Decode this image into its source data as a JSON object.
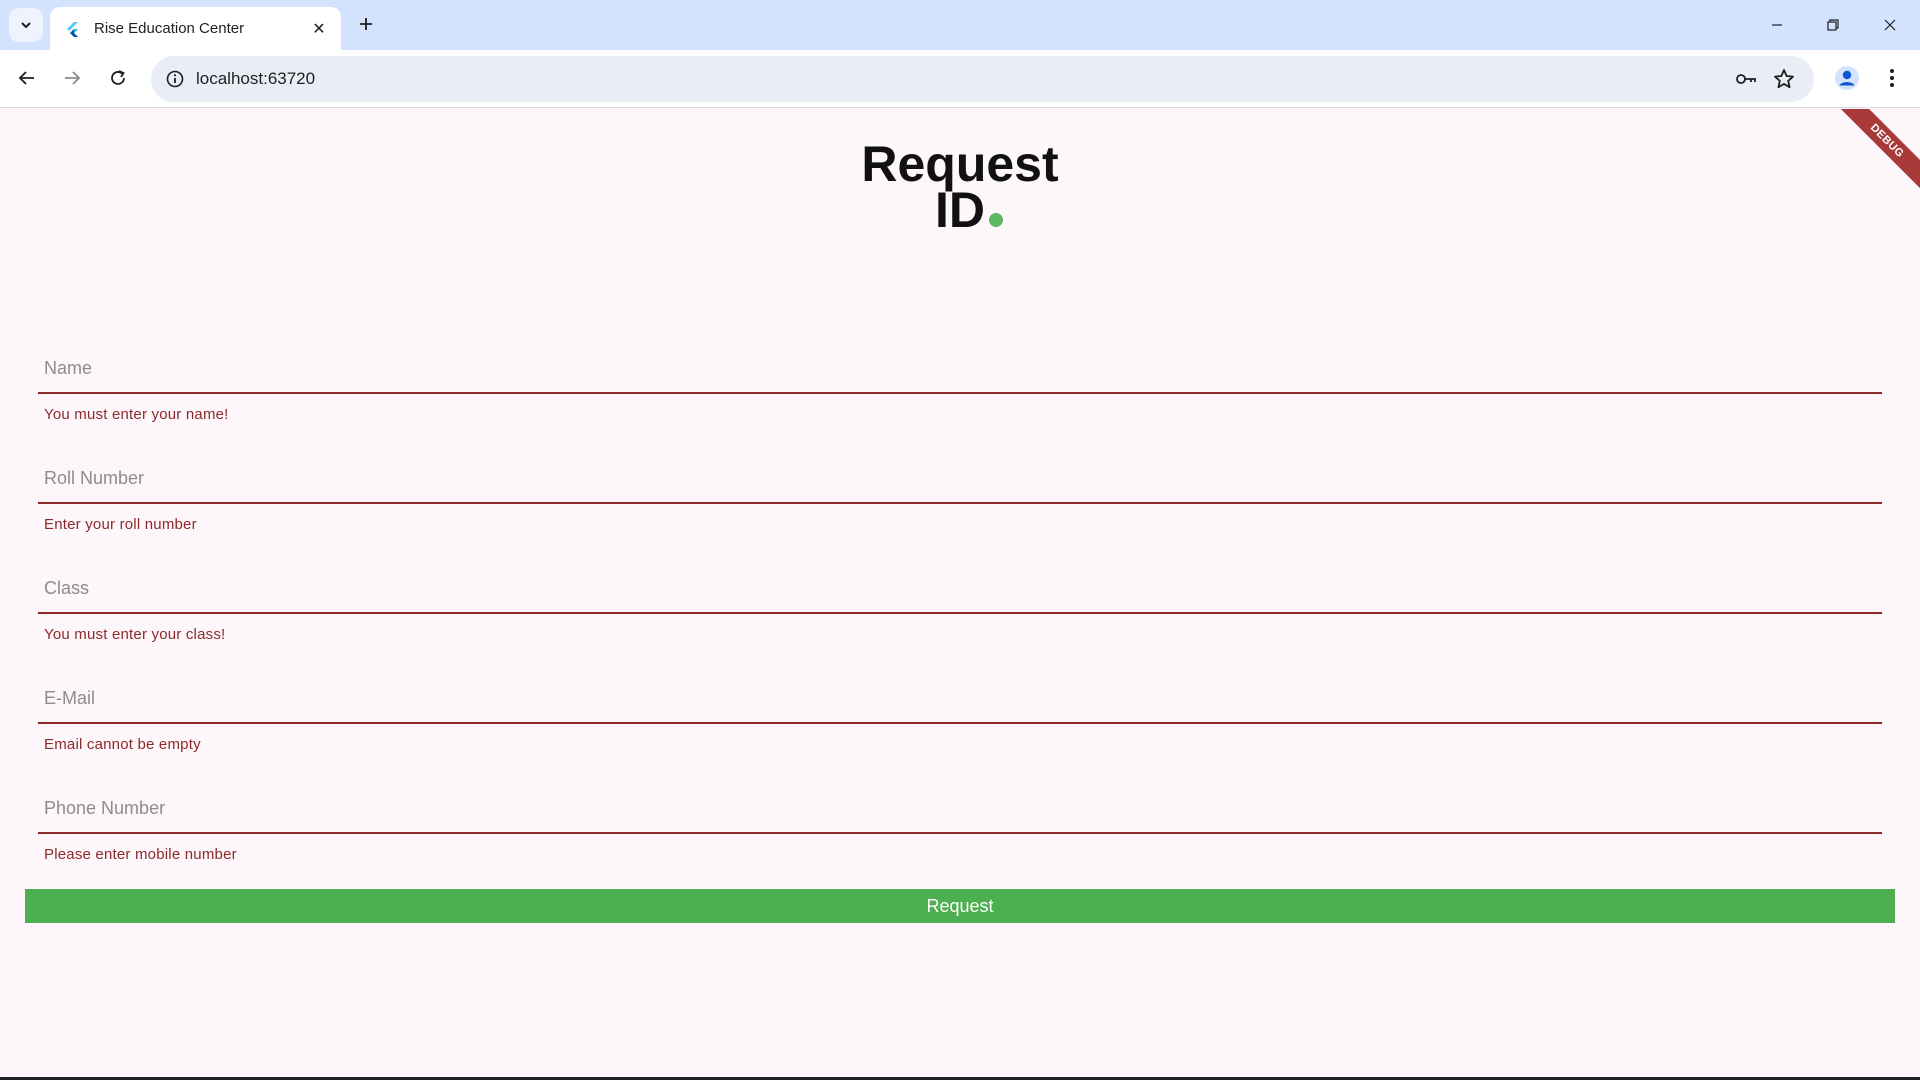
{
  "browser": {
    "tab_title": "Rise Education Center",
    "url": "localhost:63720"
  },
  "app": {
    "debug_label": "DEBUG",
    "title_line1": "Request",
    "title_line2": "ID",
    "accent_color": "#5cba62",
    "error_color": "#8c2a2a",
    "fields": [
      {
        "label": "Name",
        "error": "You must enter your name!"
      },
      {
        "label": "Roll Number",
        "error": "Enter your roll number"
      },
      {
        "label": "Class",
        "error": "You must enter your class!"
      },
      {
        "label": "E-Mail",
        "error": "Email cannot be empty"
      },
      {
        "label": "Phone Number",
        "error": "Please enter mobile number"
      }
    ],
    "submit_label": "Request",
    "submit_color": "#4caf50"
  }
}
